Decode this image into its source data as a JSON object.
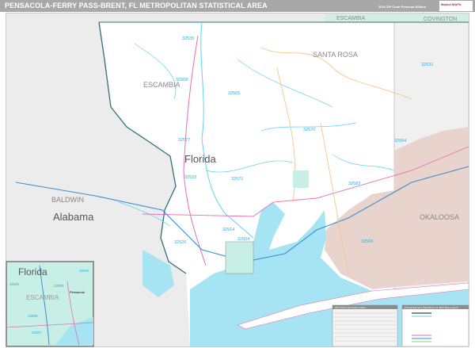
{
  "header": {
    "title": "PENSACOLA-FERRY PASS-BRENT, FL METROPOLITAN STATISTICAL AREA",
    "edition": "2020 ZIP Code Premium Edition",
    "logo_text": "Market MAPS"
  },
  "map": {
    "states": [
      "Florida",
      "Alabama"
    ],
    "counties": [
      "ESCAMBIA",
      "SANTA ROSA",
      "OKALOOSA",
      "BALDWIN",
      "ESCAMBIA",
      "COVINGTON"
    ],
    "zip_codes": [
      "32535",
      "32568",
      "32565",
      "32570",
      "32531",
      "32577",
      "32583",
      "32564",
      "32566",
      "32533",
      "32571",
      "32514",
      "32526",
      "32504"
    ],
    "colors": {
      "water": "#a6e3f3",
      "alabama": "#ececec",
      "military": "#e8d3cd",
      "state_line": "#2f6f7a",
      "zip_boundary": "#5fd3ee",
      "interstate": "#3a8fd0",
      "us_highway": "#e66fb5",
      "state_road": "#f3c78c"
    }
  },
  "inset": {
    "state": "Florida",
    "county": "ESCAMBIA",
    "city": "Pensacola",
    "zip_codes": [
      "32504",
      "32503",
      "32505",
      "32506",
      "32507"
    ]
  },
  "legend": {
    "zip_table_title": "ZIP Code Index/Grid Location",
    "map_key_title": "Pensacola-Ferry Pass-Brent, FL MSA Map Legend"
  }
}
